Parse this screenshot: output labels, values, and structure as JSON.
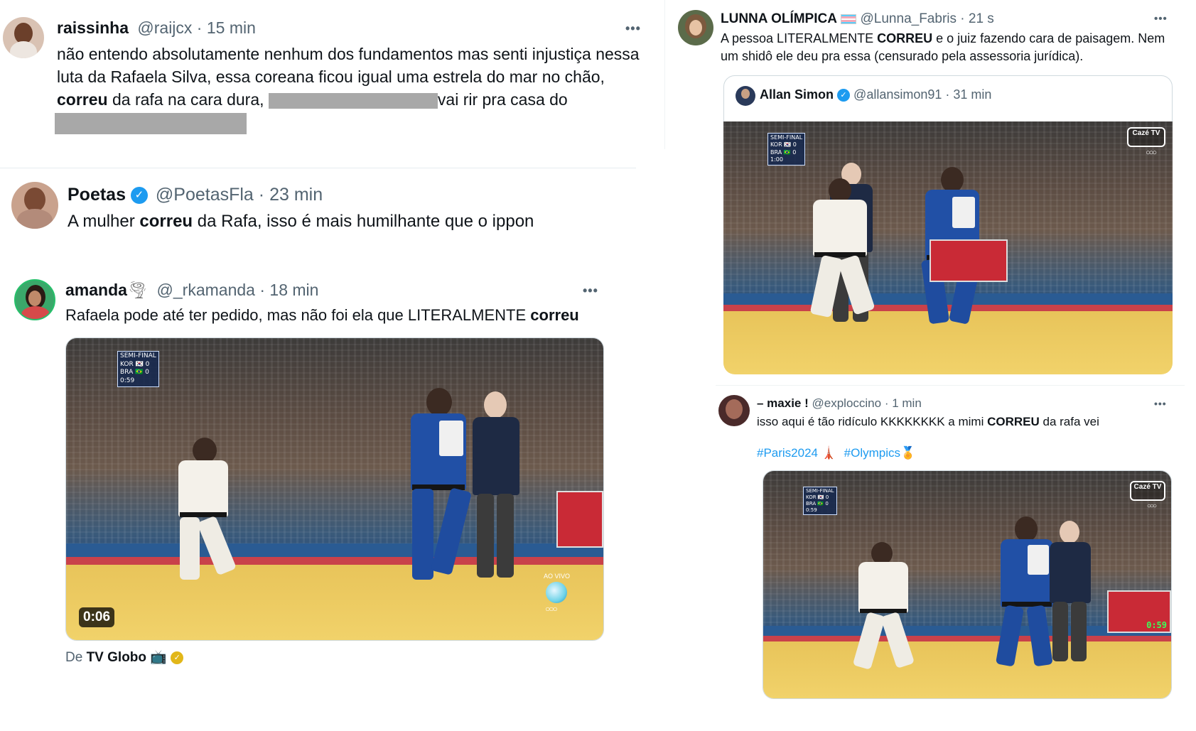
{
  "tweet1": {
    "name": "raissinha",
    "handle": "@raijcx",
    "time": "15 min",
    "more": "•••",
    "text_a": "não entendo absolutamente nenhum dos fundamentos mas senti injustiça nessa luta da Rafaela Silva, essa coreana ficou igual uma estrela do mar no chão, ",
    "text_bold": "correu",
    "text_b": " da rafa na cara dura, ",
    "text_c": "vai rir pra casa do"
  },
  "tweet2": {
    "name": "Poetas",
    "handle": "@PoetasFla",
    "time": "23 min",
    "text_a": "A mulher ",
    "text_bold": "correu",
    "text_b": " da Rafa, isso é mais humilhante que o ippon"
  },
  "tweet3": {
    "name": "amanda",
    "name_emoji": "🌪",
    "handle": "@_rkamanda",
    "time": "18 min",
    "more": "•••",
    "text_a": "Rafaela pode até ter pedido, mas não foi ela que LITERALMENTE ",
    "text_bold": "correu",
    "video_time": "0:06",
    "source_prefix": "De ",
    "source_name": "TV Globo",
    "source_emoji": "📺",
    "scoreboard": [
      "SEMI-FINAL",
      "KOR 🇰🇷 0",
      "BRA 🇧🇷 0",
      "0:59"
    ],
    "watermark": "AO VIVO"
  },
  "tweet4": {
    "name": "LUNNA OLÍMPICA",
    "handle": "@Lunna_Fabris",
    "time": "21 s",
    "more": "•••",
    "text_a": "A pessoa LITERALMENTE ",
    "text_bold": "CORREU",
    "text_b": " e o juiz fazendo cara de paisagem. Nem um shidô ele deu pra essa (censurado pela assessoria jurídica).",
    "flag_colors": [
      "#5bcefa",
      "#f5a9b8",
      "#ffffff",
      "#f5a9b8",
      "#5bcefa"
    ],
    "quote": {
      "name": "Allan Simon",
      "handle": "@allansimon91",
      "time": "31 min",
      "scoreboard": [
        "SEMI-FINAL",
        "KOR 🇰🇷 0",
        "BRA 🇧🇷 0",
        "1:00"
      ],
      "tv_logo": "Cazé TV"
    }
  },
  "tweet5": {
    "name": "– maxie !",
    "handle": "@exploccino",
    "time": "1 min",
    "more": "•••",
    "text_a": "isso aqui é tão ridículo KKKKKKKK a mimi ",
    "text_bold": "CORREU",
    "text_b": " da rafa vei",
    "hashtag1": "#Paris2024",
    "hashtag1_emoji": "🗼",
    "hashtag2": "#Olympics",
    "hashtag2_emoji": "🏅",
    "scoreboard": [
      "SEMI-FINAL",
      "KOR 🇰🇷 0",
      "BRA 🇧🇷 0",
      "0:59"
    ],
    "tv_logo": "Cazé TV",
    "clock": "0:59"
  },
  "rings": "○○○",
  "verified_check": "✓",
  "sep": " · ",
  "colors": {
    "accent": "#1d9bf0",
    "muted": "#536471",
    "mat": "#f1d26a",
    "gi_blue": "#2150a6"
  }
}
